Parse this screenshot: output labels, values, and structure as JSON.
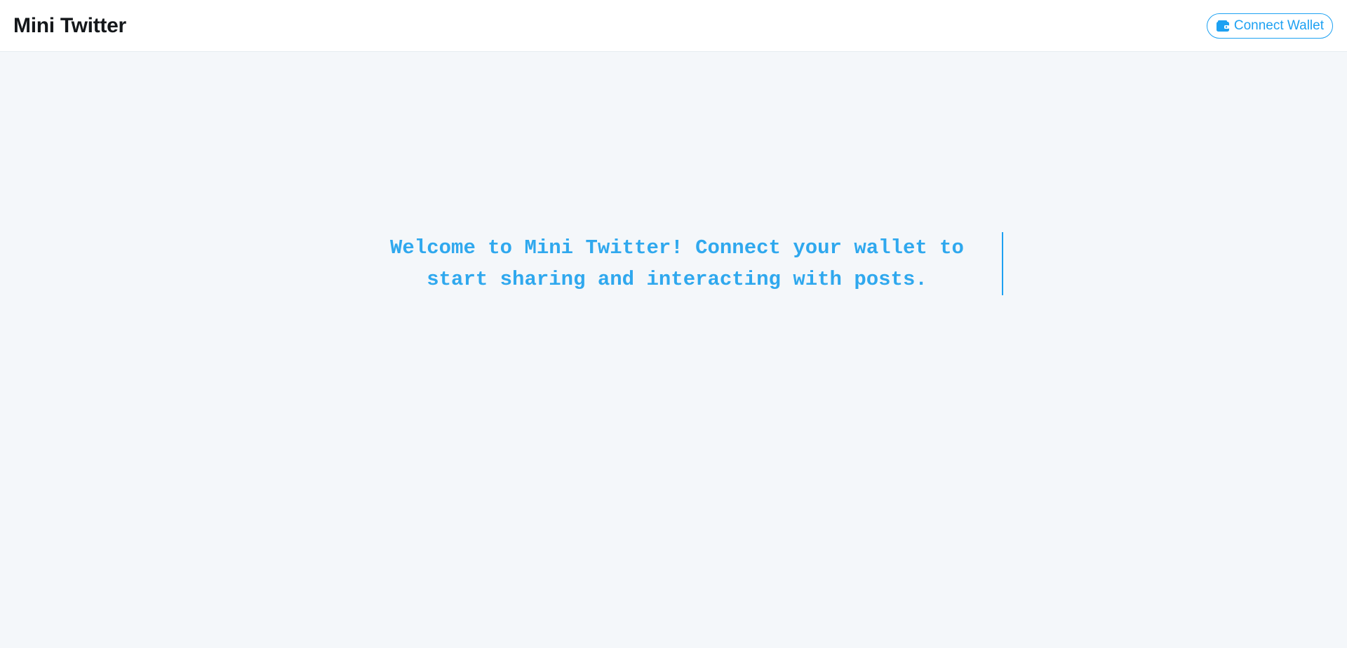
{
  "header": {
    "brand": "Mini Twitter",
    "connect_button": {
      "label": "Connect Wallet",
      "icon": "wallet-icon"
    }
  },
  "main": {
    "welcome_message": "Welcome to Mini Twitter! Connect your wallet to start sharing and interacting with posts."
  },
  "colors": {
    "accent": "#1da1f2",
    "background": "#f4f7fa",
    "header_bg": "#ffffff",
    "brand_text": "#14171a"
  }
}
